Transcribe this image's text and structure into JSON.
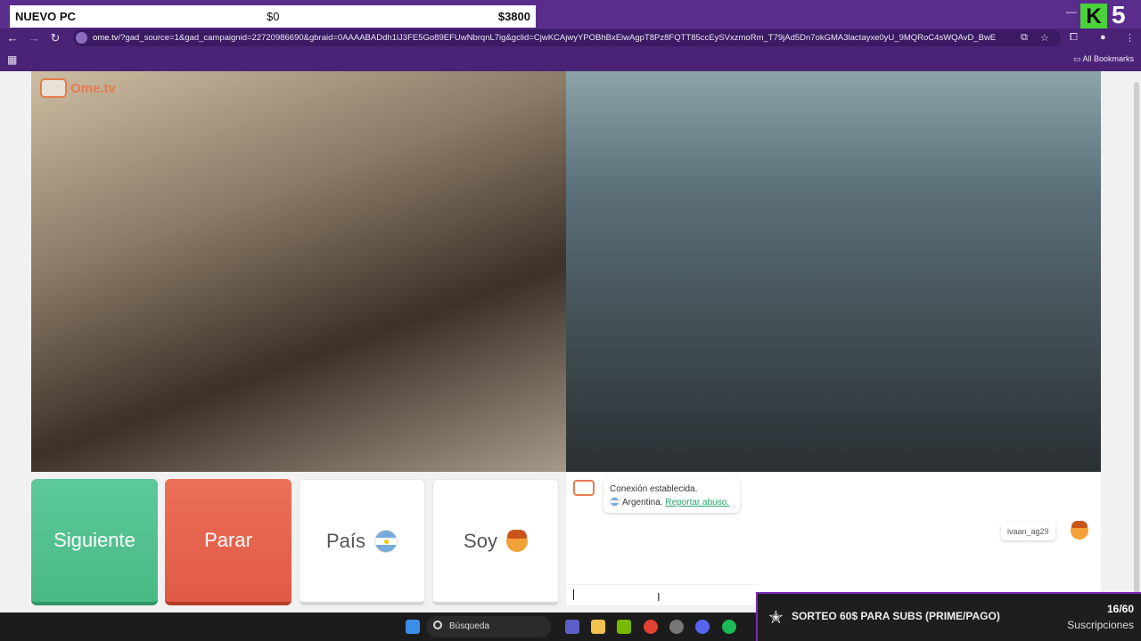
{
  "stream_overlay": {
    "goal_label": "NUEVO PC",
    "goal_current": "$0",
    "goal_target": "$3800",
    "kick_number": "5",
    "kick_logo": "K",
    "banner_title": "SORTEO 60$ PARA SUBS (PRIME/PAGO)",
    "banner_count": "16/60",
    "banner_sub": "Suscripciones"
  },
  "browser": {
    "url_host": "ome.tv",
    "url_rest": "/?gad_source=1&gad_campaignid=22720986690&gbraid=0AAAABADdh1lJ3FE5Go89EFUwNbrqnL7ig&gclid=CjwKCAjwyYPOBhBxEiwAgpT8Pz8FQTT85ccEySVxzmoRm_T79jAd5Dn7okGMA3lactayxe0yU_9MQRoC4sWQAvD_BwE",
    "bookmarks_label": "All Bookmarks"
  },
  "site": {
    "logo_text": "Ome.tv"
  },
  "controls": {
    "next_label": "Siguiente",
    "stop_label": "Parar",
    "country_label": "País",
    "gender_label": "Soy"
  },
  "chat": {
    "status": "Conexión establecida.",
    "country": "Argentina.",
    "report_link": "Reportar abuso.",
    "username": "ivaan_ag29"
  },
  "taskbar": {
    "search_label": "Búsqueda"
  }
}
